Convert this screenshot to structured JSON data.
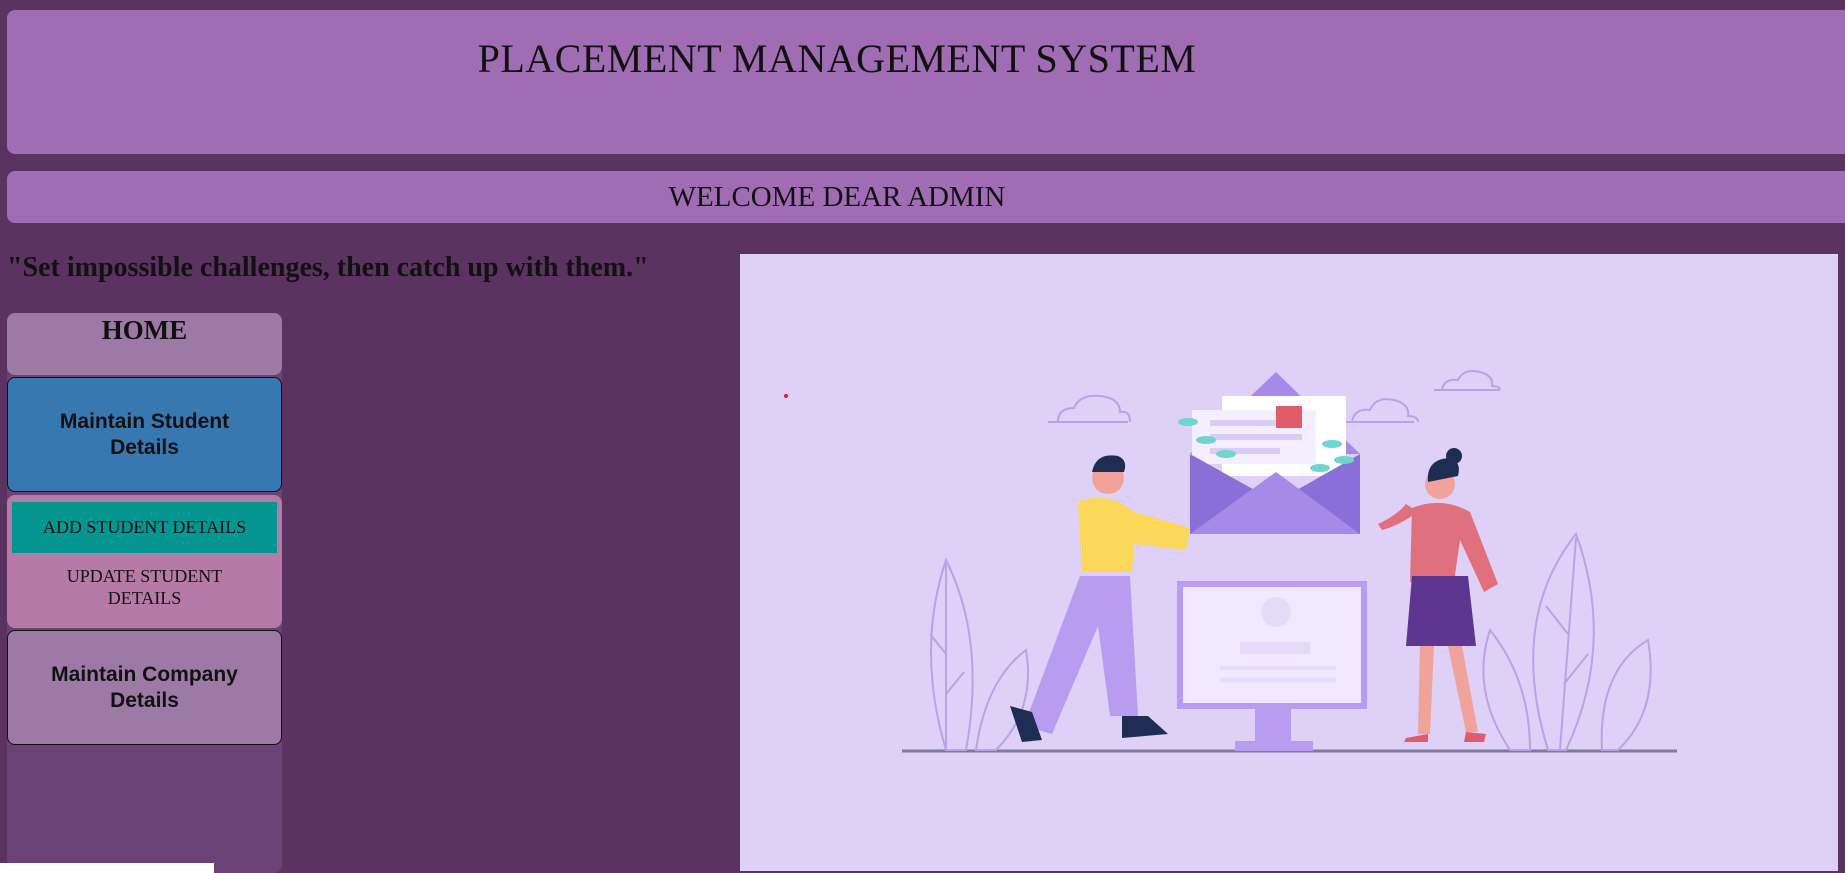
{
  "header": {
    "title": "PLACEMENT MANAGEMENT SYSTEM"
  },
  "welcome": {
    "text": "WELCOME DEAR ADMIN"
  },
  "quote": {
    "text": "\"Set impossible challenges, then catch up with them.\""
  },
  "sidebar": {
    "home_label": "HOME",
    "student_label": "Maintain Student Details",
    "student_menu": {
      "add_label": "ADD STUDENT DETAILS",
      "update_label": "UPDATE STUDENT DETAILS"
    },
    "company_label": "Maintain Company Details"
  },
  "colors": {
    "page_bg": "#5b3360",
    "banner": "#a06db4",
    "student_button": "#3778b0",
    "add_item": "#059691",
    "dropdown": "#b57aa8",
    "illustration_bg": "#ded0f6"
  }
}
